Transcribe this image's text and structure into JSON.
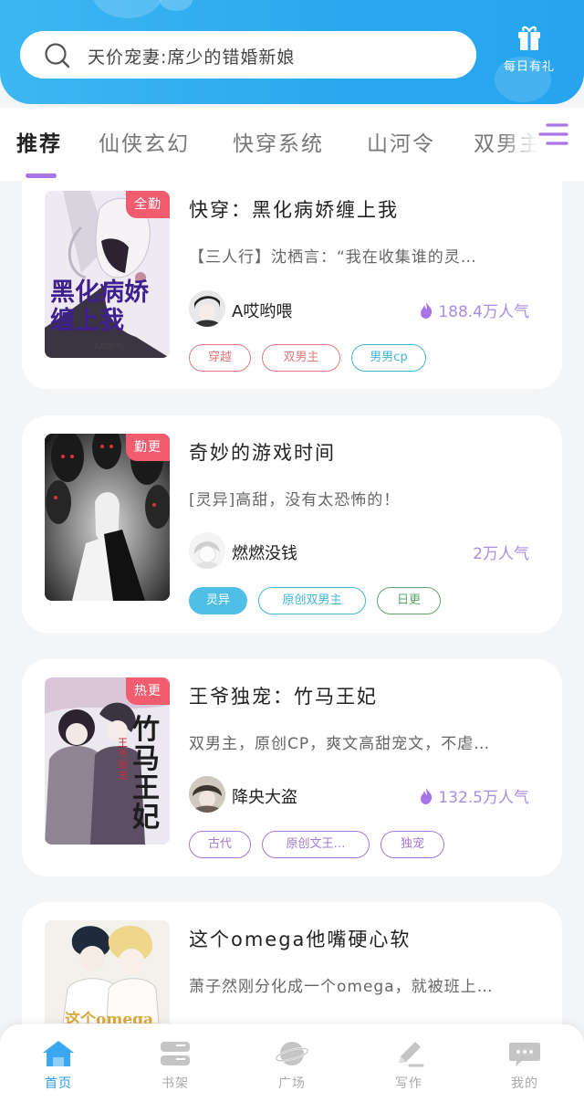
{
  "search": {
    "text": "天价宠妻:席少的错婚新娘"
  },
  "daily_gift": {
    "label": "每日有礼",
    "icon": "gift-icon"
  },
  "tabs": [
    {
      "label": "推荐",
      "active": true
    },
    {
      "label": "仙侠玄幻"
    },
    {
      "label": "快穿系统"
    },
    {
      "label": "山河令"
    },
    {
      "label": "双男主"
    }
  ],
  "books": [
    {
      "badge": "全勤",
      "cover_title": "黑化病娇缠上我",
      "cover_author": "A哎哟喂",
      "title": "快穿：黑化病娇缠上我",
      "desc": "【三人行】沈栖言：“我在收集谁的灵…",
      "author": "A哎哟喂",
      "popularity": "188.4万人气",
      "hot": true,
      "tags": [
        {
          "label": "穿越",
          "color": "#e07a7a"
        },
        {
          "label": "双男主",
          "color": "#e07a7a"
        },
        {
          "label": "男男cp",
          "color": "#3fb6d6"
        }
      ]
    },
    {
      "badge": "勤更",
      "title": "奇妙的游戏时间",
      "desc": "[灵异]高甜，没有太恐怖的！",
      "author": "燃燃没钱",
      "popularity": "2万人气",
      "hot": false,
      "tags": [
        {
          "label": "灵异",
          "color": "#3fb6d6",
          "filled": true
        },
        {
          "label": "原创双男主",
          "color": "#3fb6d6"
        },
        {
          "label": "日更",
          "color": "#5aa86a"
        }
      ]
    },
    {
      "badge": "热更",
      "cover_title": "竹马王妃",
      "cover_sub": "王爷独宠",
      "title": "王爷独宠：竹马王妃",
      "desc": "双男主，原创CP，爽文高甜宠文，不虐…",
      "author": "降央大盗",
      "popularity": "132.5万人气",
      "hot": true,
      "tags": [
        {
          "label": "古代",
          "color": "#a37ad8"
        },
        {
          "label": "原创文王…",
          "color": "#a37ad8"
        },
        {
          "label": "独宠",
          "color": "#a37ad8"
        }
      ]
    },
    {
      "badge": "",
      "cover_title": "这个omega",
      "title": "这个omega他嘴硬心软",
      "desc": "萧子然刚分化成一个omega，就被班上…"
    }
  ],
  "bottom_nav": [
    {
      "label": "首页",
      "icon": "home-icon",
      "active": true
    },
    {
      "label": "书架",
      "icon": "bookshelf-icon"
    },
    {
      "label": "广场",
      "icon": "planet-icon"
    },
    {
      "label": "写作",
      "icon": "pen-icon"
    },
    {
      "label": "我的",
      "icon": "chat-bubble-icon"
    }
  ],
  "colors": {
    "header_blue": "#2aa8ef",
    "badge_red": "#f25c6f",
    "accent_purple": "#a874e8",
    "popularity_purple": "#a88ee3",
    "nav_active": "#2b9bea"
  }
}
